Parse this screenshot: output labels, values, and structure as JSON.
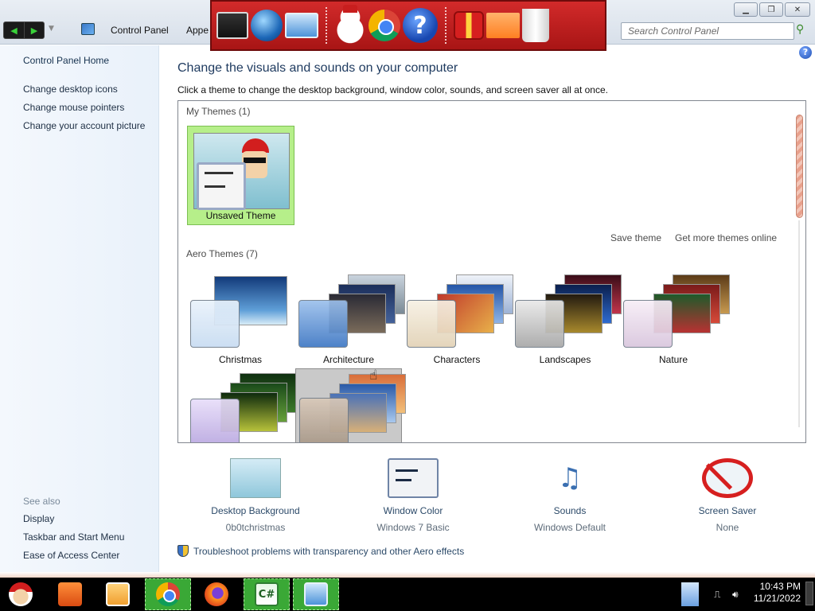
{
  "addressbar": {
    "breadcrumb": [
      "Control Panel",
      "Appe"
    ],
    "search_placeholder": "Search Control Panel"
  },
  "dock": {
    "icons": [
      "computer-icon",
      "globe-icon",
      "screen-icon",
      "snowman-icon",
      "chrome-icon",
      "help-icon",
      "gift-icon",
      "folder-icon",
      "recycle-bin-icon"
    ]
  },
  "left_pane": {
    "home": "Control Panel Home",
    "links": [
      "Change desktop icons",
      "Change mouse pointers",
      "Change your account picture"
    ],
    "see_also_label": "See also",
    "see_also": [
      "Display",
      "Taskbar and Start Menu",
      "Ease of Access Center"
    ]
  },
  "main": {
    "title": "Change the visuals and sounds on your computer",
    "subtitle": "Click a theme to change the desktop background, window color, sounds, and screen saver all at once.",
    "my_themes_header": "My Themes (1)",
    "unsaved_theme": "Unsaved Theme",
    "save_theme": "Save theme",
    "get_more": "Get more themes online",
    "aero_header": "Aero Themes (7)",
    "aero_themes": [
      "Christmas",
      "Architecture",
      "Characters",
      "Landscapes",
      "Nature"
    ]
  },
  "settings": [
    {
      "name": "Desktop Background",
      "value": "0b0tchristmas"
    },
    {
      "name": "Window Color",
      "value": "Windows 7 Basic"
    },
    {
      "name": "Sounds",
      "value": "Windows Default"
    },
    {
      "name": "Screen Saver",
      "value": "None"
    }
  ],
  "troubleshoot": "Troubleshoot problems with transparency and other Aero effects",
  "taskbar": {
    "time": "10:43 PM",
    "date": "11/21/2022",
    "csharp_label": "C#"
  },
  "colors": {
    "dock_red": "#c41f1f",
    "unsaved_green": "#b6ef8a",
    "selected_tile": "#c9c9c9",
    "taskbar_active": "#3aa836"
  }
}
